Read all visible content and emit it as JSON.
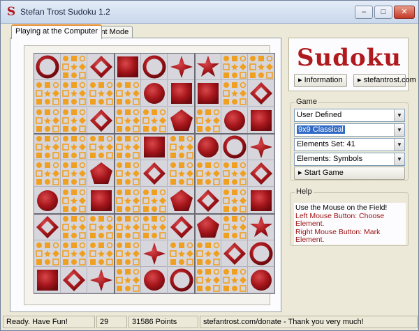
{
  "window": {
    "title": "Stefan Trost Sudoku 1.2",
    "controls": {
      "minimize": "–",
      "maximize": "□",
      "close": "✕"
    }
  },
  "tabs": [
    {
      "label": "Playing at the Computer",
      "active": true
    },
    {
      "label": "Print Mode",
      "active": false
    }
  ],
  "board": {
    "rows": [
      [
        "ring",
        "small",
        "diamond",
        "square",
        "ring",
        "star4",
        "star5",
        "small",
        "small"
      ],
      [
        "small",
        "small",
        "small",
        "small",
        "ball",
        "square",
        "square",
        "small",
        "diamond"
      ],
      [
        "small",
        "small",
        "diamond",
        "small",
        "small",
        "pentagon",
        "small",
        "ball",
        "square"
      ],
      [
        "small",
        "small",
        "small",
        "small",
        "square",
        "small",
        "ball",
        "ring",
        "star4"
      ],
      [
        "small",
        "small",
        "pentagon",
        "small",
        "diamond",
        "small",
        "small",
        "small",
        "diamond"
      ],
      [
        "ball",
        "small",
        "square",
        "small",
        "small",
        "pentagon",
        "diamond",
        "small",
        "square"
      ],
      [
        "diamond",
        "small",
        "small",
        "small",
        "small",
        "diamond",
        "pentagon",
        "small",
        "star5"
      ],
      [
        "small",
        "small",
        "small",
        "small",
        "star4",
        "small",
        "small",
        "diamond",
        "ring"
      ],
      [
        "square",
        "diamond",
        "star4",
        "small",
        "ball",
        "ring",
        "small",
        "small",
        "ball"
      ]
    ]
  },
  "logo": {
    "text": "Sudoku"
  },
  "links": {
    "information": "Information",
    "website": "stefantrost.com"
  },
  "game": {
    "label": "Game",
    "mode": "User Defined",
    "variant": "9x9 Classical",
    "elements_set": "Elements Set: 41",
    "elements_type": "Elements: Symbols",
    "start": "Start Game"
  },
  "help": {
    "label": "Help",
    "line1": "Use the Mouse on the Field!",
    "line2": "Left Mouse Button: Choose Element.",
    "line3": "Right Mouse Button: Mark Element."
  },
  "status": {
    "message": "Ready. Have Fun!",
    "count": "29",
    "points": "31586 Points",
    "donate": "stefantrost.com/donate - Thank you very much!"
  },
  "colors": {
    "accent": "#b0191d",
    "orange": "#f0a020",
    "cell_bg": "#d6d6dc"
  }
}
